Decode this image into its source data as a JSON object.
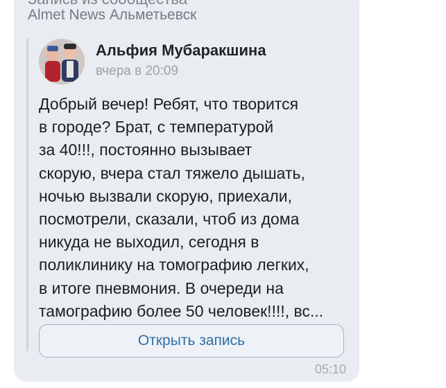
{
  "community": {
    "line1": "Запись из сообщества",
    "name": "Almet News Альметьевск"
  },
  "post": {
    "author": "Альфия Мубаракшина",
    "time": "вчера в 20:09",
    "text_lines": [
      "Добрый вечер! Ребят, что творится",
      "в городе? Брат, с температурой",
      "за 40!!!, постоянно вызывает",
      "скорую, вчера стал тяжело дышать,",
      "ночью вызвали скорую, приехали,",
      "посмотрели, сказали, чтоб из дома",
      "никуда не выходил, сегодня в",
      "поликлинику на томографию легких,",
      "в итоге пневмония. В очереди на",
      "тамографию более 50 человек!!!!, вс..."
    ],
    "open_button": "Открыть запись"
  },
  "message": {
    "time": "05:10"
  },
  "colors": {
    "bubble": "#e9ecf0",
    "accent": "#2f6ea8"
  },
  "icons": {
    "avatar": "user-avatar-photo"
  }
}
